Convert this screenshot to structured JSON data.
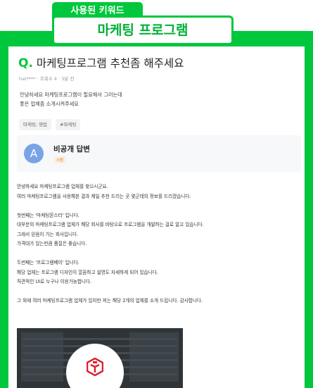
{
  "header": {
    "keyword_label": "사용된 키워드",
    "keyword": "마케팅 프로그램"
  },
  "question": {
    "mark": "Q.",
    "title": "마케팅프로그램 추천좀 해주세요",
    "author": "hat****",
    "views": "조회수 4",
    "time": "3분 전",
    "body": [
      "안녕하세요 마케팅프로그램이 필요해서 그러는데",
      "좋은 업체좀 소개시켜주세요"
    ],
    "tags": [
      "마케팅, 영업",
      "#마케팅"
    ]
  },
  "answer": {
    "avatar_letter": "A",
    "name": "비공개 답변",
    "badge": "시원",
    "paragraphs": [
      "안녕하세요 마케팅프로그램 업체를 찾으시군요.",
      "여러 마케팅프로그램을 사용해본 결과 제일 추천 드리는 곳 몇군데의 정보를 드리겠습니다.",
      "",
      "첫번째는 '마케팅몬스터' 입니다.",
      "대부분의 마케팅프로그램 업체가 해당 회사를 바탕으로 프로그램을 개발하는 걸로 알고 있습니다.",
      "그래서 믿음이 가는 회사입니다.",
      "가격대가 있는만큼 품질은 좋습니다.",
      "",
      "두번째는 '프로그램베이' 입니다.",
      "해당 업체는 프로그램 디자인이 깔끔하고 설명도 자세하게 되어 있습니다.",
      "직관적인 UI로 누구나 이용가능합니다.",
      "",
      "그 외에 여러 마케팅프로그램 업체가 있지만 저는 해당 2개의 업체를 소개 드립니다. 감사합니다."
    ]
  },
  "colors": {
    "brand_green": "#00c73c",
    "avatar_blue": "#7aa3e6",
    "logo_red": "#d9232e"
  }
}
